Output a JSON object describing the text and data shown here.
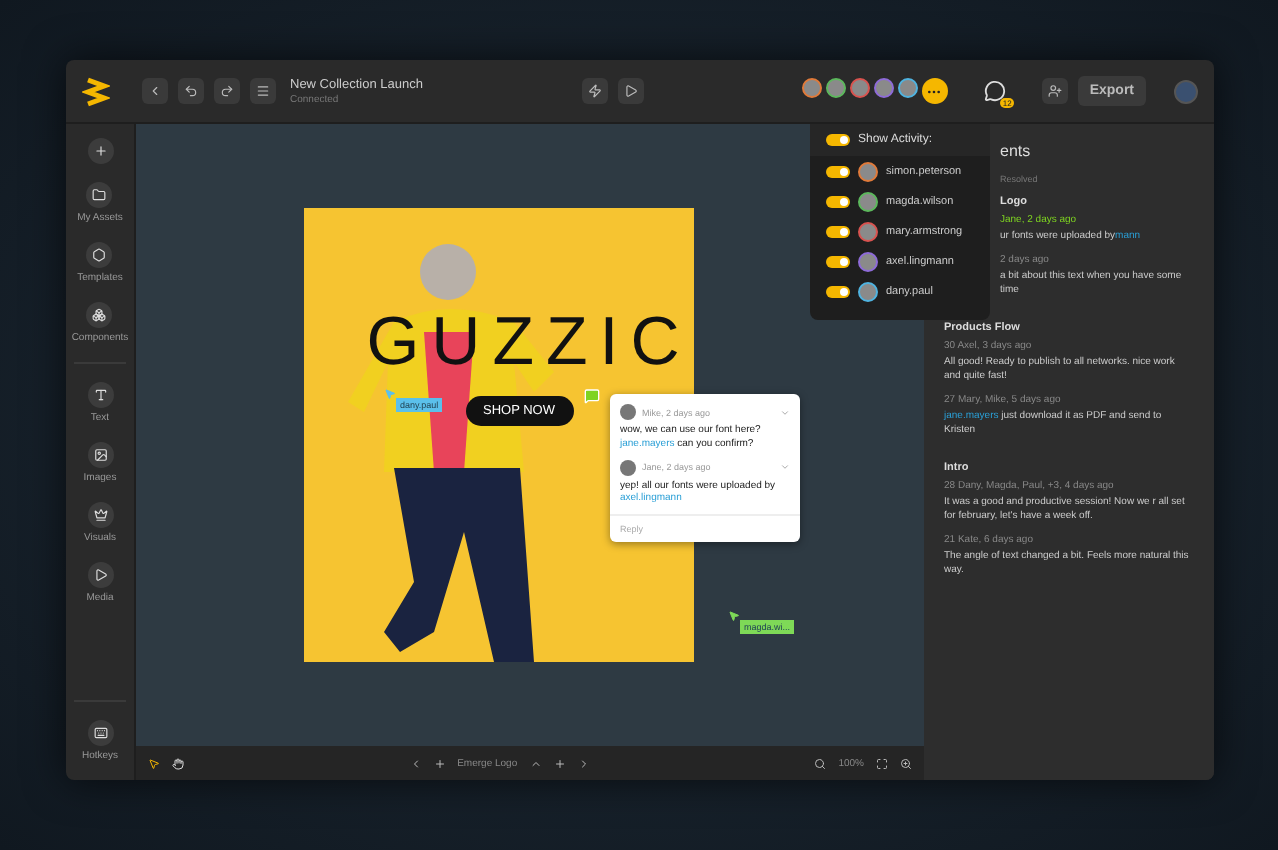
{
  "toolbar": {
    "title": "New Collection Launch",
    "status": "Connected",
    "collaborators": [
      {
        "color": "#e07a3a"
      },
      {
        "color": "#5cb85c"
      },
      {
        "color": "#d9534f"
      },
      {
        "color": "#8e6bd8"
      },
      {
        "color": "#4fb3e0"
      }
    ],
    "chat_badge": "12",
    "export": "Export"
  },
  "sidebar": {
    "groups": [
      [
        {
          "kind": "add"
        },
        {
          "kind": "assets",
          "label": "My Assets"
        },
        {
          "kind": "templates",
          "label": "Templates"
        },
        {
          "kind": "components",
          "label": "Components"
        }
      ],
      [
        {
          "kind": "text",
          "label": "Text"
        },
        {
          "kind": "images",
          "label": "Images"
        },
        {
          "kind": "visuals",
          "label": "Visuals"
        },
        {
          "kind": "media",
          "label": "Media"
        }
      ]
    ],
    "hotkeys": {
      "kind": "hotkeys",
      "label": "Hotkeys"
    }
  },
  "activity": {
    "label": "Show Activity:",
    "on": true,
    "users": [
      {
        "name": "simon.peterson",
        "on": true,
        "color": "#e07a3a"
      },
      {
        "name": "magda.wilson",
        "on": true,
        "color": "#5cb85c"
      },
      {
        "name": "mary.armstrong",
        "on": true,
        "color": "#d9534f"
      },
      {
        "name": "axel.lingmann",
        "on": true,
        "color": "#8e6bd8"
      },
      {
        "name": "dany.paul",
        "on": true,
        "color": "#4fb3e0"
      }
    ]
  },
  "design": {
    "headline": "GUZZIC",
    "cta": "SHOP NOW",
    "cursors": [
      {
        "name": "dany.paul",
        "color": "#5bc0eb"
      },
      {
        "name": "magda.wi...",
        "color": "#7ed957"
      }
    ]
  },
  "comment_card": {
    "comments": [
      {
        "meta": "Mike, 2 days ago",
        "segments": [
          {
            "kind": "text",
            "text": "wow, we can use our font here? "
          },
          {
            "kind": "link",
            "text": "jane.mayers"
          },
          {
            "kind": "text",
            "text": " can you confirm?"
          }
        ]
      },
      {
        "meta": "Jane, 2 days ago",
        "segments": [
          {
            "kind": "text",
            "text": "yep! all our fonts were uploaded by "
          },
          {
            "kind": "link",
            "text": "axel.lingmann"
          }
        ]
      }
    ],
    "reply": "Reply"
  },
  "comments_panel": {
    "title": "ents",
    "filter": "Resolved",
    "threads": [
      {
        "title": "Logo",
        "covered": true,
        "comments": [
          {
            "meta": "Jane, 2 days ago",
            "highlighted": true,
            "segments": [
              {
                "kind": "text",
                "text": "ur fonts were uploaded by"
              },
              {
                "kind": "link",
                "text": "mann"
              }
            ]
          },
          {
            "meta": "2 days ago",
            "highlighted": false,
            "segments": [
              {
                "kind": "text",
                "text": "a bit about this text when you have some time"
              }
            ]
          }
        ]
      },
      {
        "title": "Products Flow",
        "covered": false,
        "comments": [
          {
            "count": "30",
            "meta": "Axel, 3 days ago",
            "highlighted": false,
            "segments": [
              {
                "kind": "text",
                "text": "All good! Ready to publish to all networks. nice work and quite fast!"
              }
            ]
          },
          {
            "count": "27",
            "meta": "Mary, Mike, 5 days ago",
            "highlighted": false,
            "segments": [
              {
                "kind": "link",
                "text": "jane.mayers"
              },
              {
                "kind": "text",
                "text": " just download it as PDF and send to Kristen"
              }
            ]
          }
        ]
      },
      {
        "title": "Intro",
        "covered": false,
        "comments": [
          {
            "count": "28",
            "meta": "Dany, Magda, Paul, +3, 4 days ago",
            "highlighted": false,
            "segments": [
              {
                "kind": "text",
                "text": "It was a good and productive session! Now we r all set for february, let's have a week off."
              }
            ]
          },
          {
            "count": "21",
            "meta": "Kate, 6 days ago",
            "highlighted": false,
            "segments": [
              {
                "kind": "text",
                "text": "The angle of text changed a bit. Feels more natural this way."
              }
            ]
          }
        ]
      }
    ]
  },
  "bottom_bar": {
    "tools": [
      {
        "kind": "pointer",
        "selected": true
      },
      {
        "kind": "hand",
        "selected": false
      }
    ],
    "layer": "Emerge Logo",
    "zoom": "100%"
  }
}
